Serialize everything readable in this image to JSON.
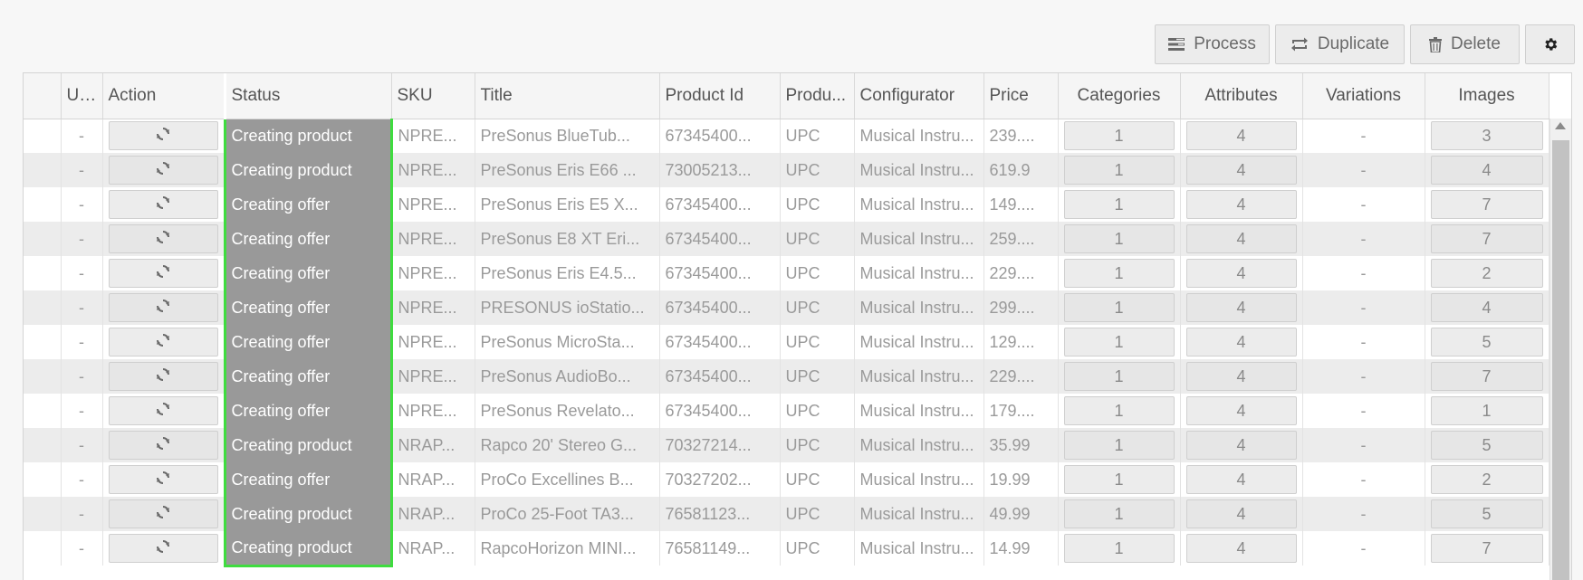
{
  "toolbar": {
    "process_label": "Process",
    "duplicate_label": "Duplicate",
    "delete_label": "Delete"
  },
  "table": {
    "headers": {
      "url": "URL",
      "action": "Action",
      "status": "Status",
      "sku": "SKU",
      "title": "Title",
      "product_id": "Product Id",
      "product_type": "Produ...",
      "configurator": "Configurator",
      "price": "Price",
      "categories": "Categories",
      "attributes": "Attributes",
      "variations": "Variations",
      "images": "Images"
    },
    "rows": [
      {
        "url": "-",
        "status": "Creating product",
        "sku": "NPRE...",
        "title": "PreSonus BlueTub...",
        "product_id": "67345400...",
        "product_type": "UPC",
        "configurator": "Musical Instru...",
        "price": "239....",
        "categories": "1",
        "attributes": "4",
        "variations": "-",
        "images": "3"
      },
      {
        "url": "-",
        "status": "Creating product",
        "sku": "NPRE...",
        "title": "PreSonus Eris E66 ...",
        "product_id": "73005213...",
        "product_type": "UPC",
        "configurator": "Musical Instru...",
        "price": "619.9",
        "categories": "1",
        "attributes": "4",
        "variations": "-",
        "images": "4"
      },
      {
        "url": "-",
        "status": "Creating offer",
        "sku": "NPRE...",
        "title": "PreSonus Eris E5 X...",
        "product_id": "67345400...",
        "product_type": "UPC",
        "configurator": "Musical Instru...",
        "price": "149....",
        "categories": "1",
        "attributes": "4",
        "variations": "-",
        "images": "7"
      },
      {
        "url": "-",
        "status": "Creating offer",
        "sku": "NPRE...",
        "title": "PreSonus E8 XT Eri...",
        "product_id": "67345400...",
        "product_type": "UPC",
        "configurator": "Musical Instru...",
        "price": "259....",
        "categories": "1",
        "attributes": "4",
        "variations": "-",
        "images": "7"
      },
      {
        "url": "-",
        "status": "Creating offer",
        "sku": "NPRE...",
        "title": "PreSonus Eris E4.5...",
        "product_id": "67345400...",
        "product_type": "UPC",
        "configurator": "Musical Instru...",
        "price": "229....",
        "categories": "1",
        "attributes": "4",
        "variations": "-",
        "images": "2"
      },
      {
        "url": "-",
        "status": "Creating offer",
        "sku": "NPRE...",
        "title": "PRESONUS ioStatio...",
        "product_id": "67345400...",
        "product_type": "UPC",
        "configurator": "Musical Instru...",
        "price": "299....",
        "categories": "1",
        "attributes": "4",
        "variations": "-",
        "images": "4"
      },
      {
        "url": "-",
        "status": "Creating offer",
        "sku": "NPRE...",
        "title": "PreSonus MicroSta...",
        "product_id": "67345400...",
        "product_type": "UPC",
        "configurator": "Musical Instru...",
        "price": "129....",
        "categories": "1",
        "attributes": "4",
        "variations": "-",
        "images": "5"
      },
      {
        "url": "-",
        "status": "Creating offer",
        "sku": "NPRE...",
        "title": "PreSonus AudioBo...",
        "product_id": "67345400...",
        "product_type": "UPC",
        "configurator": "Musical Instru...",
        "price": "229....",
        "categories": "1",
        "attributes": "4",
        "variations": "-",
        "images": "7"
      },
      {
        "url": "-",
        "status": "Creating offer",
        "sku": "NPRE...",
        "title": "PreSonus Revelato...",
        "product_id": "67345400...",
        "product_type": "UPC",
        "configurator": "Musical Instru...",
        "price": "179....",
        "categories": "1",
        "attributes": "4",
        "variations": "-",
        "images": "1"
      },
      {
        "url": "-",
        "status": "Creating product",
        "sku": "NRAP...",
        "title": "Rapco 20' Stereo G...",
        "product_id": "70327214...",
        "product_type": "UPC",
        "configurator": "Musical Instru...",
        "price": "35.99",
        "categories": "1",
        "attributes": "4",
        "variations": "-",
        "images": "5"
      },
      {
        "url": "-",
        "status": "Creating offer",
        "sku": "NRAP...",
        "title": "ProCo Excellines B...",
        "product_id": "70327202...",
        "product_type": "UPC",
        "configurator": "Musical Instru...",
        "price": "19.99",
        "categories": "1",
        "attributes": "4",
        "variations": "-",
        "images": "2"
      },
      {
        "url": "-",
        "status": "Creating product",
        "sku": "NRAP...",
        "title": "ProCo 25-Foot TA3...",
        "product_id": "76581123...",
        "product_type": "UPC",
        "configurator": "Musical Instru...",
        "price": "49.99",
        "categories": "1",
        "attributes": "4",
        "variations": "-",
        "images": "5"
      },
      {
        "url": "-",
        "status": "Creating product",
        "sku": "NRAP...",
        "title": "RapcoHorizon MINI...",
        "product_id": "76581149...",
        "product_type": "UPC",
        "configurator": "Musical Instru...",
        "price": "14.99",
        "categories": "1",
        "attributes": "4",
        "variations": "-",
        "images": "7"
      }
    ]
  },
  "colors": {
    "status_bg": "#999999",
    "status_highlight": "#3fdc3f"
  },
  "icons": {
    "process": "process-icon",
    "duplicate": "duplicate-icon",
    "delete": "trash-icon",
    "settings": "gear-icon",
    "row_action": "refresh-icon"
  }
}
